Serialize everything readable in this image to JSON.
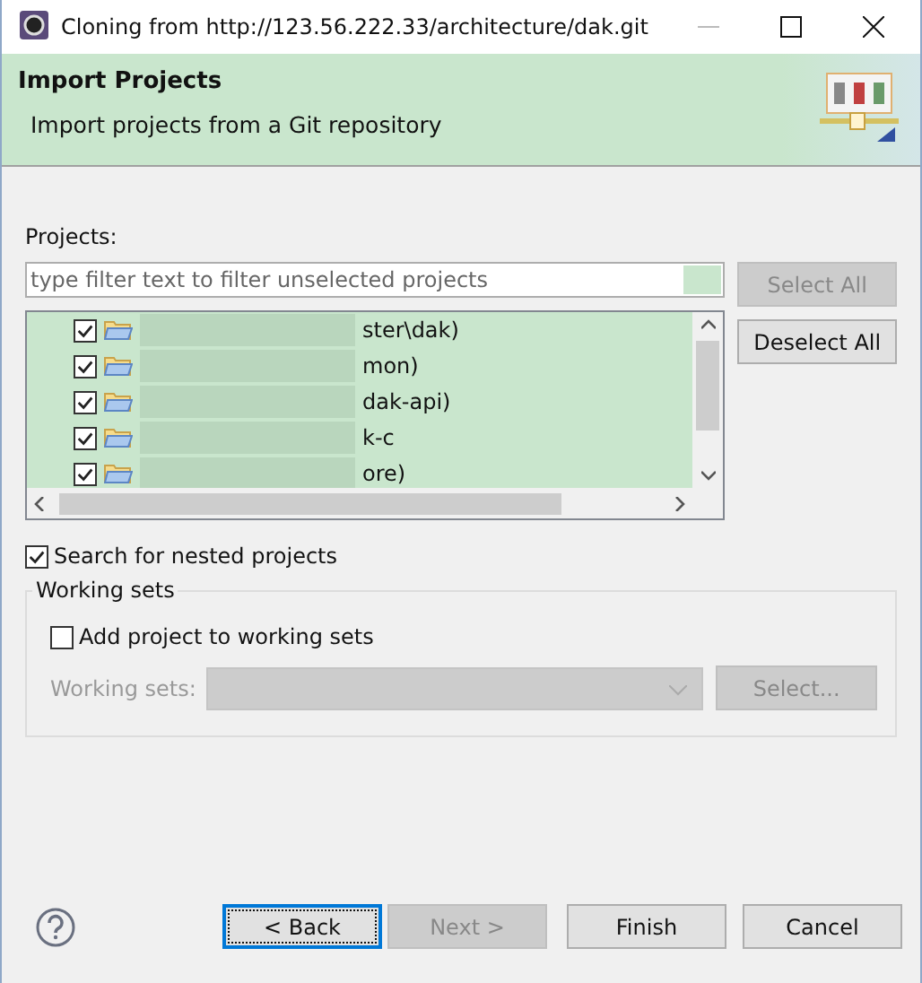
{
  "window": {
    "title": "Cloning from http://123.56.222.33/architecture/dak.git"
  },
  "header": {
    "title": "Import Projects",
    "description": "Import projects from a Git repository"
  },
  "projects": {
    "label": "Projects:",
    "filter": {
      "placeholder": "type filter text to filter unselected projects"
    },
    "items": [
      {
        "text": "ster\\dak)",
        "checked": true
      },
      {
        "text": "mon)",
        "checked": true
      },
      {
        "text": "dak-api)",
        "checked": true
      },
      {
        "text": "k-c",
        "checked": true
      },
      {
        "text": "ore)",
        "checked": true
      }
    ],
    "buttons": [
      {
        "label": "Select All",
        "disabled": true
      },
      {
        "label": "Deselect All",
        "disabled": false
      }
    ]
  },
  "nested": {
    "label": "Search for nested projects",
    "checked": true
  },
  "working_sets": {
    "title": "Working sets",
    "add": {
      "label": "Add project to working sets",
      "checked": false
    },
    "field_label": "Working sets:",
    "select_button": "Select..."
  },
  "footer": {
    "buttons": [
      {
        "label": "< Back",
        "disabled": false,
        "focused": true
      },
      {
        "label": "Next >",
        "disabled": true,
        "focused": false
      },
      {
        "label": "Finish",
        "disabled": false,
        "focused": false
      },
      {
        "label": "Cancel",
        "disabled": false,
        "focused": false
      }
    ]
  }
}
